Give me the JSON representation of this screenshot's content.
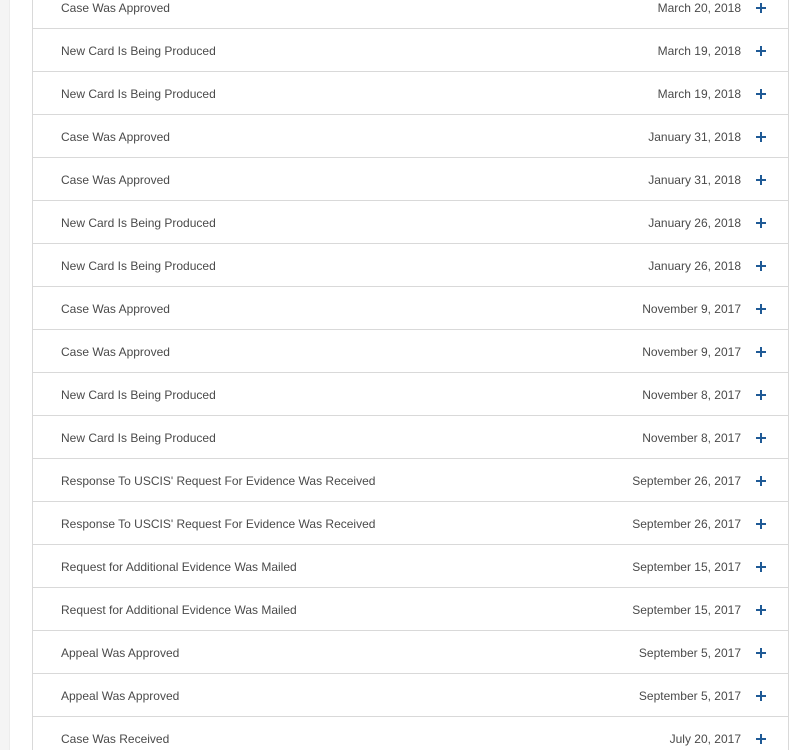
{
  "case_history": {
    "items": [
      {
        "title": "Case Was Approved",
        "date": "March 20, 2018"
      },
      {
        "title": "New Card Is Being Produced",
        "date": "March 19, 2018"
      },
      {
        "title": "New Card Is Being Produced",
        "date": "March 19, 2018"
      },
      {
        "title": "Case Was Approved",
        "date": "January 31, 2018"
      },
      {
        "title": "Case Was Approved",
        "date": "January 31, 2018"
      },
      {
        "title": "New Card Is Being Produced",
        "date": "January 26, 2018"
      },
      {
        "title": "New Card Is Being Produced",
        "date": "January 26, 2018"
      },
      {
        "title": "Case Was Approved",
        "date": "November 9, 2017"
      },
      {
        "title": "Case Was Approved",
        "date": "November 9, 2017"
      },
      {
        "title": "New Card Is Being Produced",
        "date": "November 8, 2017"
      },
      {
        "title": "New Card Is Being Produced",
        "date": "November 8, 2017"
      },
      {
        "title": "Response To USCIS' Request For Evidence Was Received",
        "date": "September 26, 2017"
      },
      {
        "title": "Response To USCIS' Request For Evidence Was Received",
        "date": "September 26, 2017"
      },
      {
        "title": "Request for Additional Evidence Was Mailed",
        "date": "September 15, 2017"
      },
      {
        "title": "Request for Additional Evidence Was Mailed",
        "date": "September 15, 2017"
      },
      {
        "title": "Appeal Was Approved",
        "date": "September 5, 2017"
      },
      {
        "title": "Appeal Was Approved",
        "date": "September 5, 2017"
      },
      {
        "title": "Case Was Received",
        "date": "July 20, 2017"
      }
    ],
    "expand_icon": "plus-icon",
    "colors": {
      "text": "#4a4a4a",
      "icon": "#1f5a96",
      "border": "#d9d9d9"
    }
  }
}
